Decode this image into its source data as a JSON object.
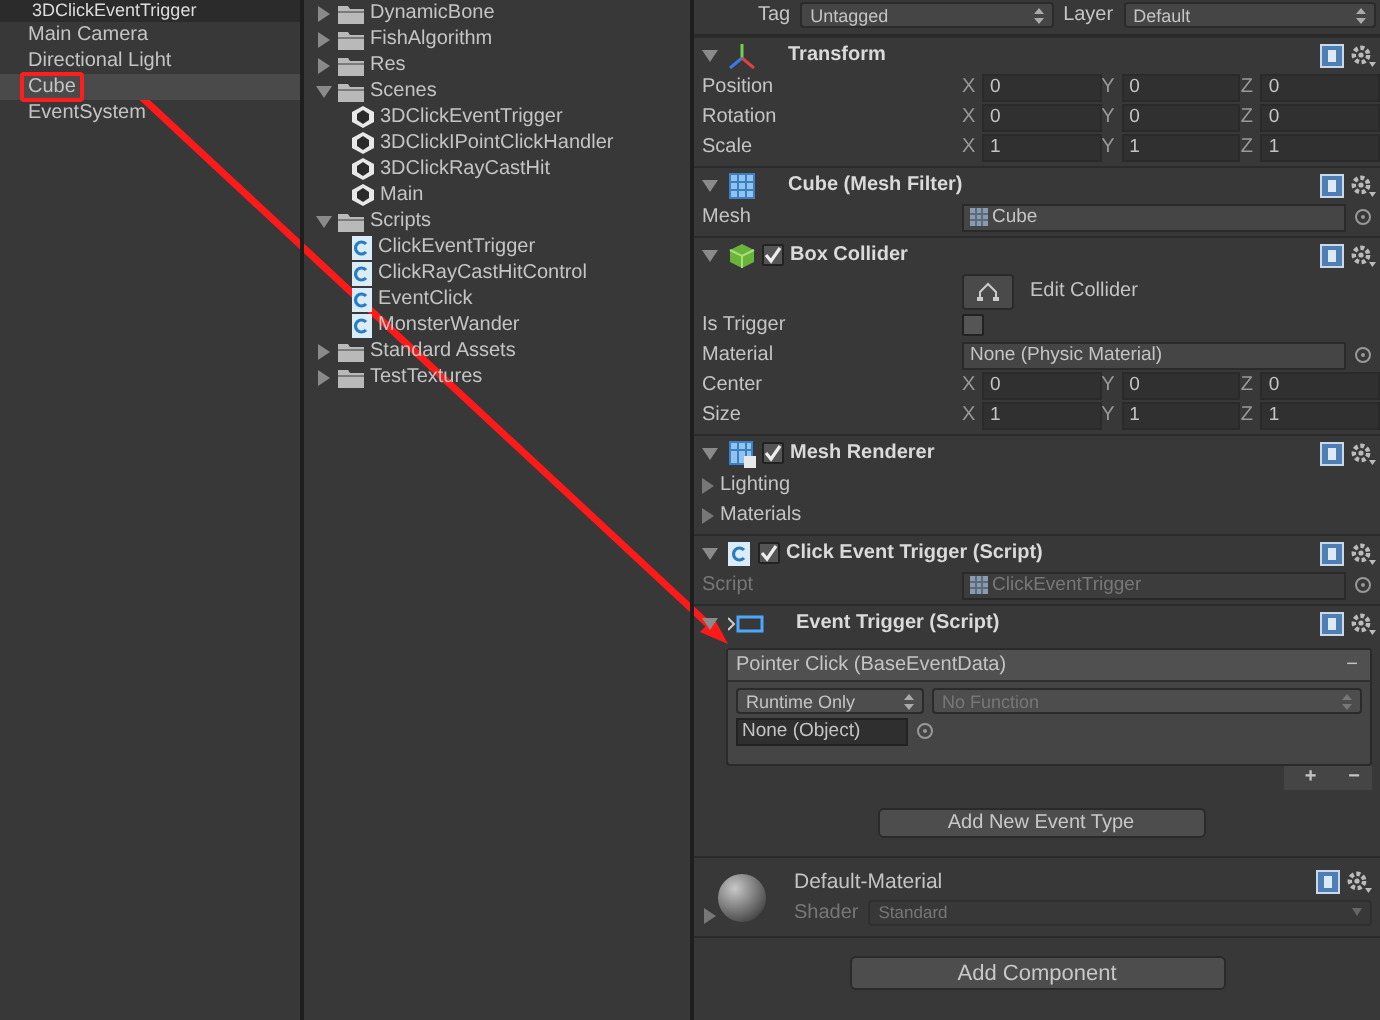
{
  "hierarchy": {
    "title": "3DClickEventTrigger",
    "items": [
      {
        "label": "Main Camera",
        "selected": false,
        "highlighted": false
      },
      {
        "label": "Directional Light",
        "selected": false,
        "highlighted": false
      },
      {
        "label": "Cube",
        "selected": true,
        "highlighted": true
      },
      {
        "label": "EventSystem",
        "selected": false,
        "highlighted": false
      }
    ]
  },
  "project": {
    "items": [
      {
        "label": "DynamicBone",
        "kind": "folder",
        "expanded": false
      },
      {
        "label": "FishAlgorithm",
        "kind": "folder",
        "expanded": false
      },
      {
        "label": "Res",
        "kind": "folder",
        "expanded": false
      },
      {
        "label": "Scenes",
        "kind": "folder",
        "expanded": true,
        "children": [
          {
            "label": "3DClickEventTrigger",
            "kind": "scene"
          },
          {
            "label": "3DClickIPointClickHandler",
            "kind": "scene"
          },
          {
            "label": "3DClickRayCastHit",
            "kind": "scene"
          },
          {
            "label": "Main",
            "kind": "scene"
          }
        ]
      },
      {
        "label": "Scripts",
        "kind": "folder",
        "expanded": true,
        "children": [
          {
            "label": "ClickEventTrigger",
            "kind": "script"
          },
          {
            "label": "ClickRayCastHitControl",
            "kind": "script"
          },
          {
            "label": "EventClick",
            "kind": "script"
          },
          {
            "label": "MonsterWander",
            "kind": "script"
          }
        ]
      },
      {
        "label": "Standard Assets",
        "kind": "folder",
        "expanded": false
      },
      {
        "label": "TestTextures",
        "kind": "folder",
        "expanded": false
      }
    ]
  },
  "inspector": {
    "tag": {
      "label": "Tag",
      "value": "Untagged"
    },
    "layer": {
      "label": "Layer",
      "value": "Default"
    },
    "components": [
      {
        "title": "Transform",
        "expanded": true,
        "rows": [
          {
            "kind": "vector3",
            "label": "Position",
            "values": [
              {
                "axis": "X",
                "value": "0"
              },
              {
                "axis": "Y",
                "value": "0"
              },
              {
                "axis": "Z",
                "value": "0"
              }
            ]
          },
          {
            "kind": "vector3",
            "label": "Rotation",
            "values": [
              {
                "axis": "X",
                "value": "0"
              },
              {
                "axis": "Y",
                "value": "0"
              },
              {
                "axis": "Z",
                "value": "0"
              }
            ]
          },
          {
            "kind": "vector3",
            "label": "Scale",
            "values": [
              {
                "axis": "X",
                "value": "1"
              },
              {
                "axis": "Y",
                "value": "1"
              },
              {
                "axis": "Z",
                "value": "1"
              }
            ]
          }
        ]
      },
      {
        "title": "Cube (Mesh Filter)",
        "expanded": true,
        "rows": [
          {
            "kind": "object",
            "label": "Mesh",
            "value": "Cube",
            "disabled": false,
            "asset_icon": true
          }
        ]
      },
      {
        "title": "Box Collider",
        "enabled": true,
        "expanded": true,
        "rows": [
          {
            "kind": "button",
            "label": "Edit Collider"
          },
          {
            "kind": "checkbox",
            "label": "Is Trigger",
            "checked": false
          },
          {
            "kind": "object",
            "label": "Material",
            "value": "None (Physic Material)",
            "disabled": false,
            "asset_icon": false
          },
          {
            "kind": "vector3",
            "label": "Center",
            "values": [
              {
                "axis": "X",
                "value": "0"
              },
              {
                "axis": "Y",
                "value": "0"
              },
              {
                "axis": "Z",
                "value": "0"
              }
            ]
          },
          {
            "kind": "vector3",
            "label": "Size",
            "values": [
              {
                "axis": "X",
                "value": "1"
              },
              {
                "axis": "Y",
                "value": "1"
              },
              {
                "axis": "Z",
                "value": "1"
              }
            ]
          }
        ]
      },
      {
        "title": "Mesh Renderer",
        "enabled": true,
        "expanded": true,
        "rows": [
          {
            "kind": "foldout",
            "label": "Lighting",
            "expanded": false
          },
          {
            "kind": "foldout",
            "label": "Materials",
            "expanded": false
          }
        ]
      },
      {
        "title": "Click Event Trigger (Script)",
        "enabled": true,
        "expanded": true,
        "rows": [
          {
            "kind": "object",
            "label": "Script",
            "value": "ClickEventTrigger",
            "disabled": true,
            "asset_icon": true
          }
        ]
      },
      {
        "title": "Event Trigger (Script)",
        "expanded": true,
        "rows": [
          {
            "kind": "event",
            "title": "Pointer Click (BaseEventData)",
            "remove": "−",
            "mode": "Runtime Only",
            "function": "No Function",
            "object": "None (Object)",
            "add": "+",
            "remove_item": "−",
            "button": "Add New Event Type"
          }
        ]
      }
    ],
    "material": {
      "name": "Default-Material",
      "shader_label": "Shader",
      "shader": "Standard"
    },
    "add_component": "Add Component"
  }
}
